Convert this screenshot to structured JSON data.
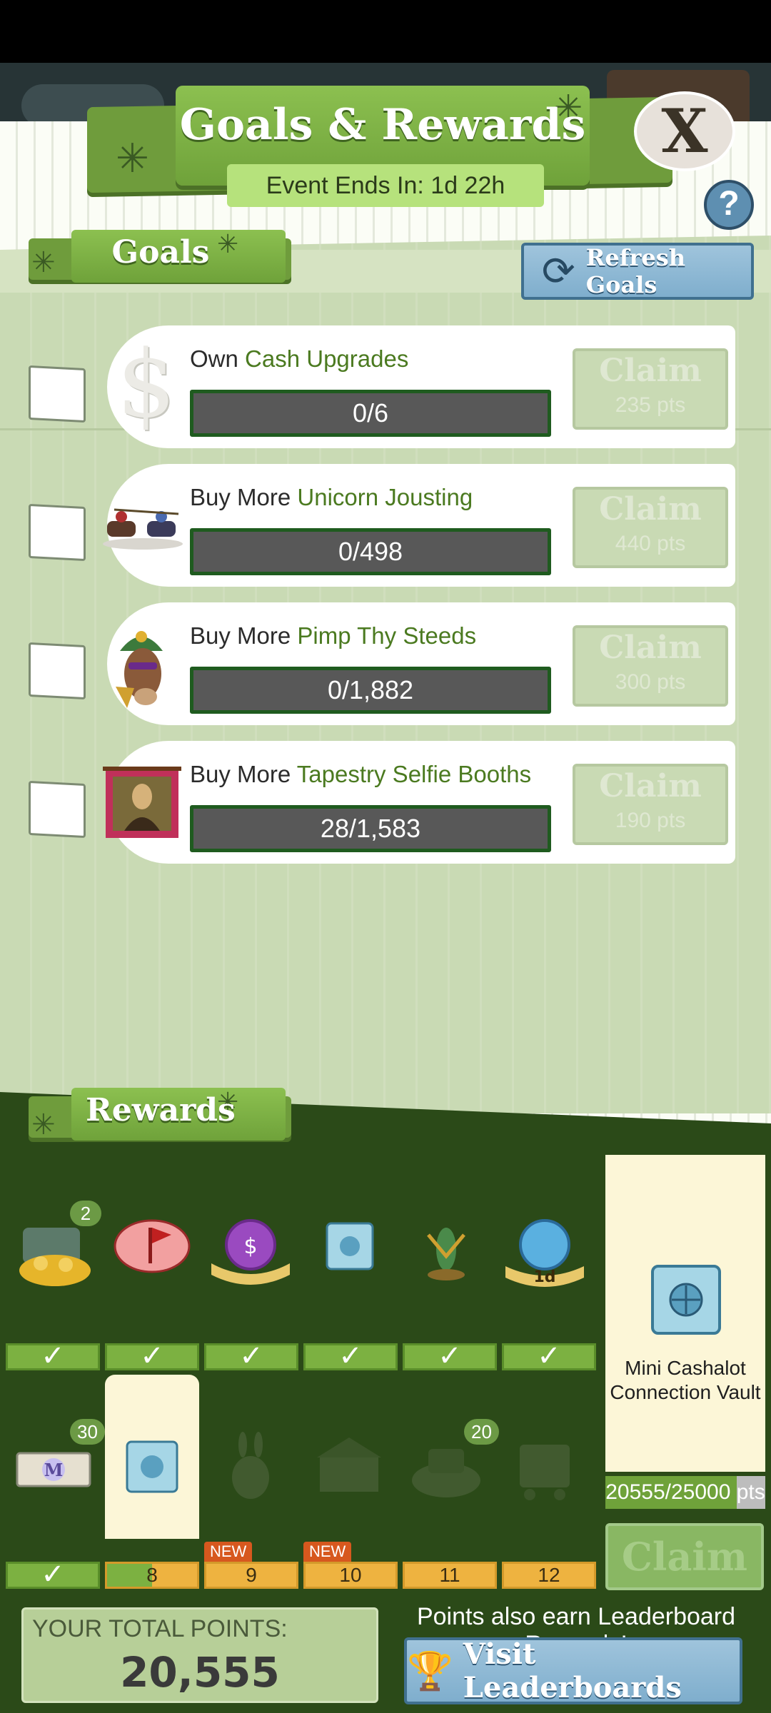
{
  "header": {
    "title": "Goals & Rewards",
    "event_ends": "Event Ends In: 1d 22h",
    "close_label": "X",
    "help_label": "?"
  },
  "goals_section": {
    "tab_label": "Goals",
    "refresh_label": "Refresh Goals"
  },
  "goals": [
    {
      "prefix": "Own",
      "target": "Cash Upgrades",
      "progress": "0/6",
      "claim": "Claim",
      "points": "235 pts",
      "icon": "dollar-sign-icon"
    },
    {
      "prefix": "Buy More",
      "target": "Unicorn Jousting",
      "progress": "0/498",
      "claim": "Claim",
      "points": "440 pts",
      "icon": "unicorn-jousting-icon"
    },
    {
      "prefix": "Buy More",
      "target": "Pimp Thy Steeds",
      "progress": "0/1,882",
      "claim": "Claim",
      "points": "300 pts",
      "icon": "decorated-horse-icon"
    },
    {
      "prefix": "Buy More",
      "target": "Tapestry Selfie Booths",
      "progress": "28/1,583",
      "claim": "Claim",
      "points": "190 pts",
      "icon": "mona-lisa-tapestry-icon"
    }
  ],
  "rewards_section": {
    "tab_label": "Rewards",
    "row1_badges": {
      "0": "2"
    },
    "row2_badges": {
      "0": "30",
      "4": "20"
    },
    "row2_numbers": [
      "8",
      "9",
      "10",
      "11",
      "12"
    ],
    "new_label": "NEW",
    "current_step_progress": 0.5
  },
  "vault": {
    "name": "Mini Cashalot Connection Vault",
    "points": "20555/25000 pts",
    "progress_fraction": 0.822,
    "claim_label": "Claim"
  },
  "footer": {
    "total_label": "YOUR TOTAL POINTS:",
    "total_value": "20,555",
    "leaderboard_note": "Points also earn Leaderboard Rewards!",
    "leaderboard_button": "Visit Leaderboards"
  },
  "colors": {
    "panel_green": "#6fa23a",
    "rewards_bg": "#2b4a18",
    "progress_border": "#1f5b1f",
    "button_blue": "#7faecd"
  }
}
